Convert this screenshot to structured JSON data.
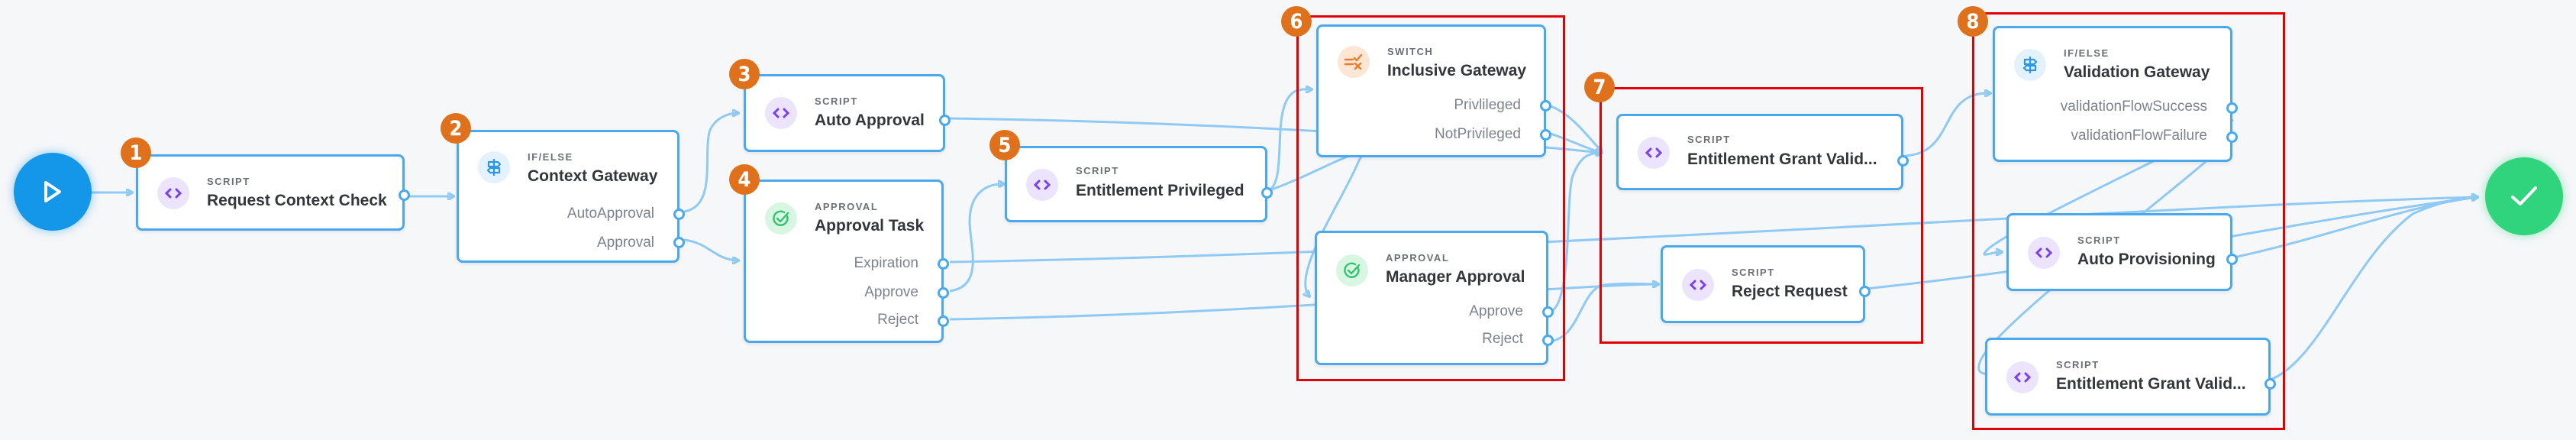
{
  "canvas": {
    "accent_color": "#4aa8ec",
    "badge_color": "#e0711c",
    "group_color": "#e40000",
    "start_color": "#1497e8",
    "end_color": "#2fd47c"
  },
  "start": {
    "icon": "play-icon"
  },
  "end": {
    "icon": "checkmark-icon"
  },
  "nodes": {
    "n1": {
      "badge": "1",
      "type": "SCRIPT",
      "title": "Request Context Check",
      "icon": "code-icon"
    },
    "n2": {
      "badge": "2",
      "type": "IF/ELSE",
      "title": "Context Gateway",
      "icon": "signpost-icon",
      "ports": [
        "AutoApproval",
        "Approval"
      ]
    },
    "n3": {
      "badge": "3",
      "type": "SCRIPT",
      "title": "Auto Approval",
      "icon": "code-icon"
    },
    "n4": {
      "badge": "4",
      "type": "APPROVAL",
      "title": "Approval Task",
      "icon": "check-circle-icon",
      "ports": [
        "Expiration",
        "Approve",
        "Reject"
      ]
    },
    "n5": {
      "badge": "5",
      "type": "SCRIPT",
      "title": "Entitlement Privileged",
      "icon": "code-icon"
    },
    "n6a": {
      "type": "SWITCH",
      "title": "Inclusive Gateway",
      "icon": "switch-icon",
      "ports": [
        "Privlileged",
        "NotPrivileged"
      ]
    },
    "n6b": {
      "type": "APPROVAL",
      "title": "Manager Approval",
      "icon": "check-circle-icon",
      "ports": [
        "Approve",
        "Reject"
      ]
    },
    "n7a": {
      "type": "SCRIPT",
      "title": "Entitlement Grant Valid...",
      "icon": "code-icon"
    },
    "n7b": {
      "type": "SCRIPT",
      "title": "Reject Request",
      "icon": "code-icon"
    },
    "n8a": {
      "type": "IF/ELSE",
      "title": "Validation Gateway",
      "icon": "signpost-icon",
      "ports": [
        "validationFlowSuccess",
        "validationFlowFailure"
      ]
    },
    "n8b": {
      "type": "SCRIPT",
      "title": "Auto Provisioning",
      "icon": "code-icon"
    },
    "n8c": {
      "type": "SCRIPT",
      "title": "Entitlement Grant Valid...",
      "icon": "code-icon"
    }
  },
  "groups": {
    "g6": {
      "badge": "6"
    },
    "g7": {
      "badge": "7"
    },
    "g8": {
      "badge": "8"
    }
  }
}
